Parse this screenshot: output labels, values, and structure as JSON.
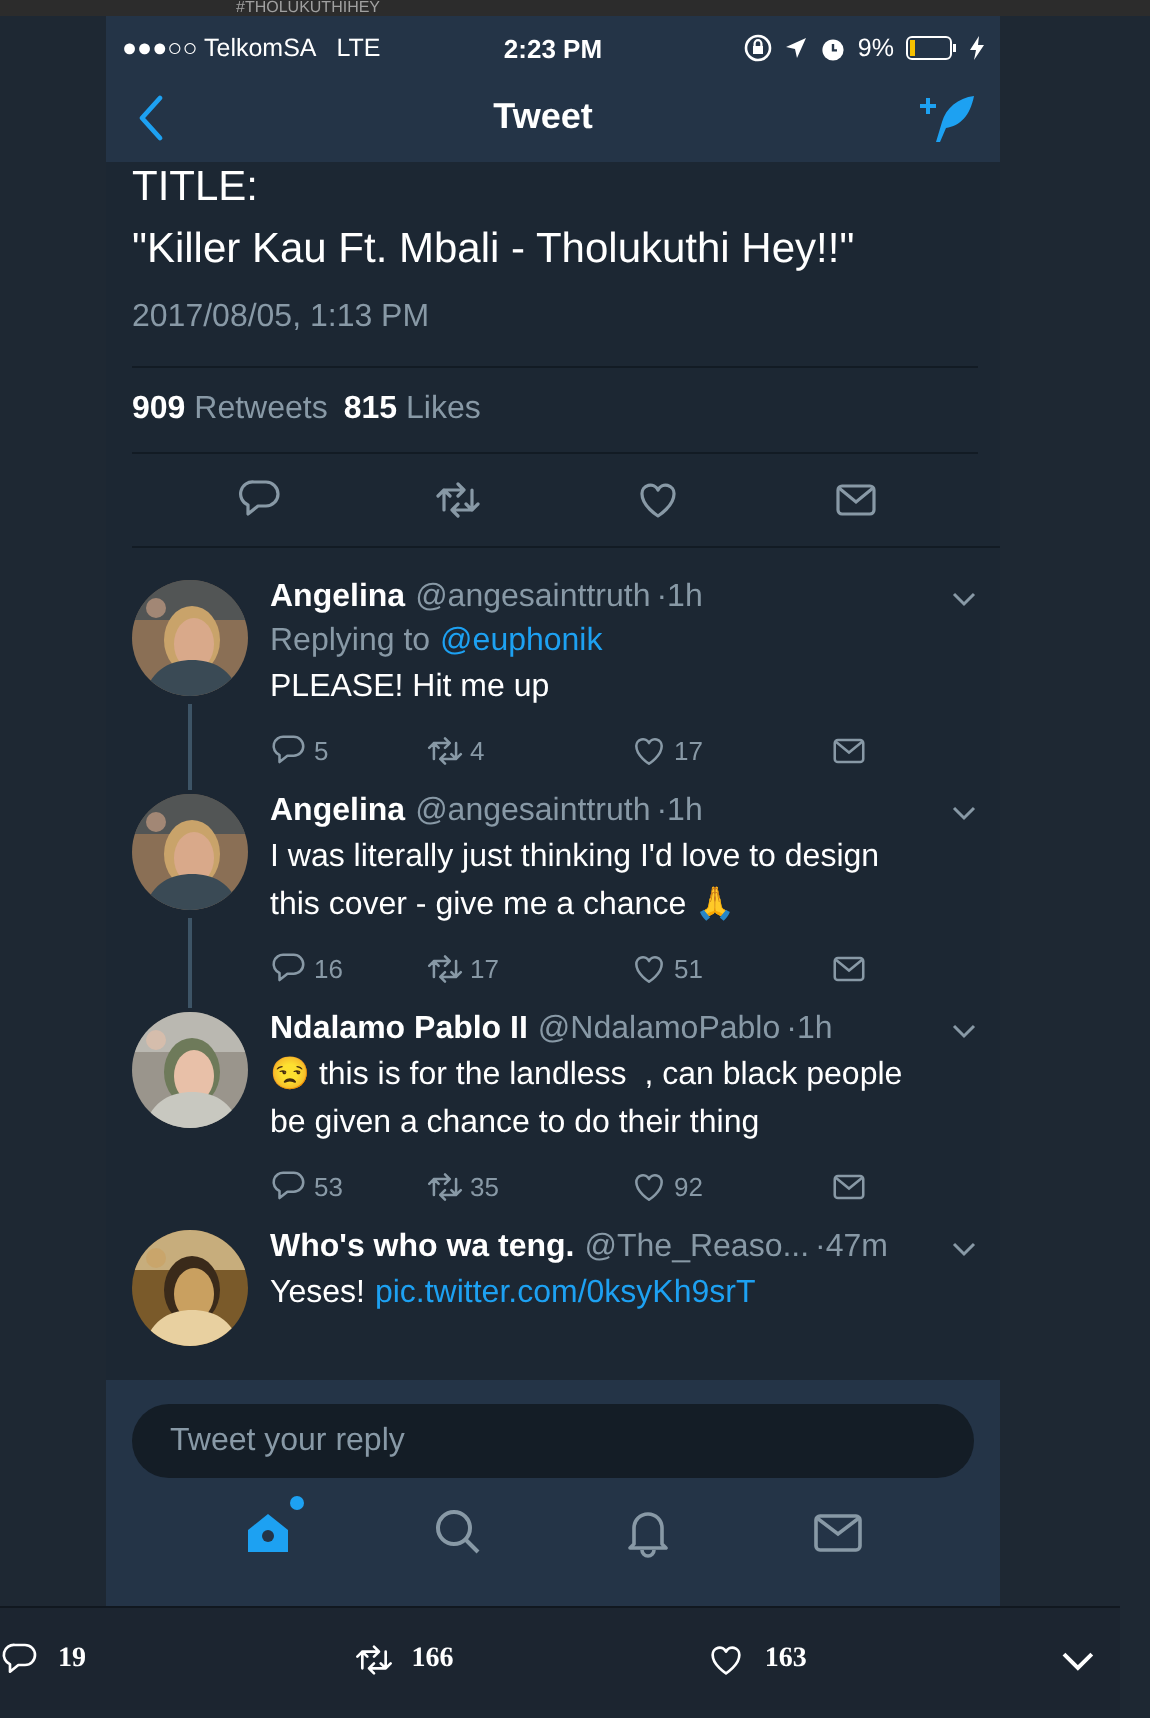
{
  "page_header": {
    "hashtag": "#THOLUKUTHIHEY"
  },
  "status_bar": {
    "carrier": "●●●○○ TelkomSA",
    "network": "LTE",
    "time": "2:23 PM",
    "battery": "9%"
  },
  "nav": {
    "title": "Tweet"
  },
  "tweet": {
    "text_lines": [
      "TITLE:",
      "\"Killer Kau Ft. Mbali - Tholukuthi Hey!!\""
    ],
    "timestamp": "2017/08/05, 1:13 PM",
    "retweet_count": "909",
    "retweet_label": "Retweets",
    "like_count": "815",
    "like_label": "Likes"
  },
  "replies": [
    {
      "name": "Angelina",
      "handle": "@angesainttruth",
      "time": "·1h",
      "replying_label": "Replying to",
      "replying_handle": "@euphonik",
      "text": "PLEASE! Hit me up",
      "thread_line": true,
      "counts": {
        "replies": "5",
        "retweets": "4",
        "likes": "17"
      }
    },
    {
      "name": "Angelina",
      "handle": "@angesainttruth",
      "time": "·1h",
      "text": "I was literally just thinking I'd love to design this cover - give me a chance 🙏",
      "thread_line": true,
      "counts": {
        "replies": "16",
        "retweets": "17",
        "likes": "51"
      }
    },
    {
      "name": "Ndalamo Pablo II",
      "handle": "@NdalamoPablo",
      "time": "·1h",
      "text": "😒 this is for the landless  , can black people be given a chance to do their thing",
      "thread_line": false,
      "counts": {
        "replies": "53",
        "retweets": "35",
        "likes": "92"
      }
    },
    {
      "name": "Who's who wa teng.",
      "handle": "@The_Reaso...",
      "time": "·47m",
      "text": "Yeses!",
      "link": "pic.twitter.com/0ksyKh9srT",
      "thread_line": false
    }
  ],
  "reply_field": {
    "placeholder": "Tweet your reply"
  },
  "tab_bar": [
    {
      "kind": "home",
      "selected": true,
      "badge": true
    },
    {
      "kind": "search",
      "selected": false
    },
    {
      "kind": "notifications",
      "selected": false
    },
    {
      "kind": "messages",
      "selected": false
    }
  ],
  "outer_actions": {
    "replies": "19",
    "retweets": "166",
    "likes": "163"
  }
}
